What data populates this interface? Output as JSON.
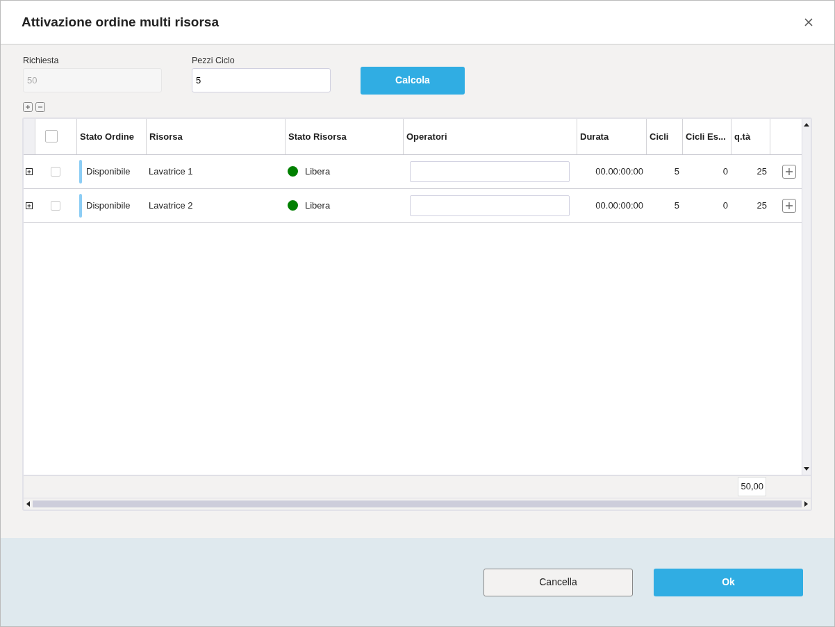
{
  "window": {
    "title": "Attivazione ordine multi risorsa"
  },
  "fields": [
    {
      "label": "Richiesta",
      "value": "50",
      "disabled": true
    },
    {
      "label": "Pezzi Ciclo",
      "value": "5",
      "disabled": false
    }
  ],
  "calculate_button": "Calcola",
  "table": {
    "header_checkbox": {
      "checked": false
    },
    "columns": [
      "Stato Ordine",
      "Risorsa",
      "Stato Risorsa",
      "Operatori",
      "Durata",
      "Cicli",
      "Cicli Es...",
      "q.tà"
    ],
    "rows": [
      {
        "checked": false,
        "order_status": {
          "text": "Disponibile",
          "color": "#8ccdf5"
        },
        "resource": "Lavatrice 1",
        "resource_status": {
          "text": "Libera",
          "color": "#008000"
        },
        "duration": "00.00:00:00",
        "cycles": "5",
        "cycles_done": "0",
        "quantity": "25"
      },
      {
        "checked": false,
        "order_status": {
          "text": "Disponibile",
          "color": "#8ccdf5"
        },
        "resource": "Lavatrice 2",
        "resource_status": {
          "text": "Libera",
          "color": "#008000"
        },
        "duration": "00.00:00:00",
        "cycles": "5",
        "cycles_done": "0",
        "quantity": "25"
      }
    ],
    "total": "50,00"
  },
  "buttons": [
    {
      "label": "Cancella",
      "kind": "secondary"
    },
    {
      "label": "Ok",
      "kind": "primary"
    }
  ]
}
